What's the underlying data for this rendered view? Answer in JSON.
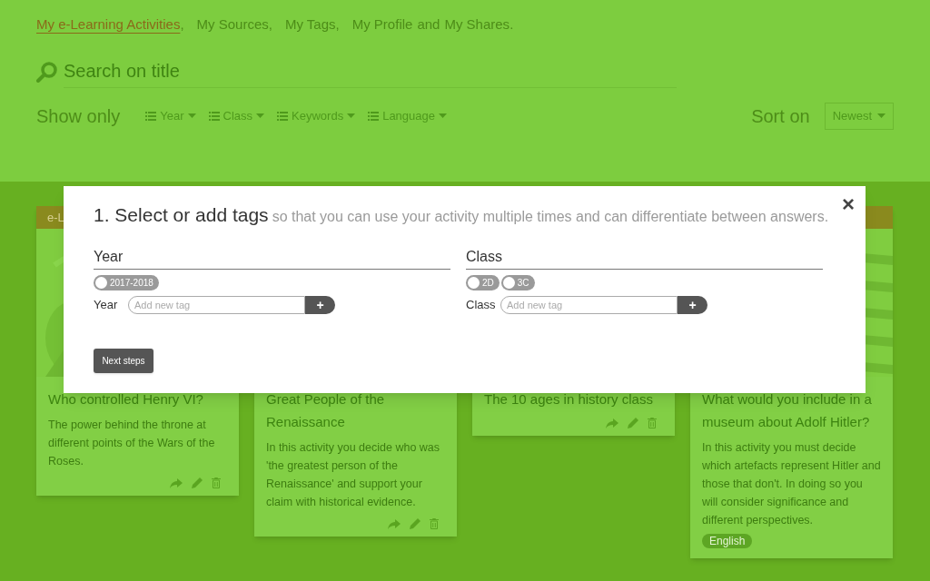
{
  "nav": [
    {
      "label": "My e-Learning Activities",
      "selected": true,
      "after": ","
    },
    {
      "label": "My Sources",
      "selected": false,
      "after": ","
    },
    {
      "label": "My Tags",
      "selected": false,
      "after": ","
    },
    {
      "label": "My Profile",
      "selected": false,
      "after": "and"
    },
    {
      "label": "My Shares",
      "selected": false,
      "after": "."
    }
  ],
  "search": {
    "placeholder": "Search on title"
  },
  "filter": {
    "label": "Show only",
    "options": [
      "Year",
      "Class",
      "Keywords",
      "Language"
    ]
  },
  "sort": {
    "label": "Sort on",
    "value": "Newest"
  },
  "cards": [
    {
      "kind": "picture",
      "header": "e-L",
      "title": "Who controlled Henry VI?",
      "description": "The power behind the throne at different points of the Wars of the Roses.",
      "actions": true
    },
    {
      "kind": "plain",
      "title": "Great People of the Renaissance",
      "description": "In this activity you decide who was 'the greatest person of the Renaissance' and support your claim with historical evidence.",
      "actions": true
    },
    {
      "kind": "plain",
      "title": "The 10 ages in history class",
      "actions": true
    },
    {
      "kind": "picture",
      "title": "What would you include in a museum about Adolf Hitler?",
      "description": "In this activity you must decide which artefacts represent Hitler and those that don't. In doing so you will consider significance and different perspectives.",
      "tag": "English",
      "actions": false
    }
  ],
  "modal": {
    "title": "1. Select or add tags",
    "subtitle": "so that you can use your activity multiple times and can differentiate between answers.",
    "close": "×",
    "groups": [
      {
        "heading": "Year",
        "tags": [
          {
            "label": "2017-2018",
            "selected": false
          }
        ],
        "add_label": "Year",
        "placeholder": "Add new tag",
        "add_button": "+"
      },
      {
        "heading": "Class",
        "tags": [
          {
            "label": "2D",
            "selected": false
          },
          {
            "label": "3C",
            "selected": false
          }
        ],
        "add_label": "Class",
        "placeholder": "Add new tag",
        "add_button": "+"
      }
    ],
    "button": "Next steps"
  }
}
